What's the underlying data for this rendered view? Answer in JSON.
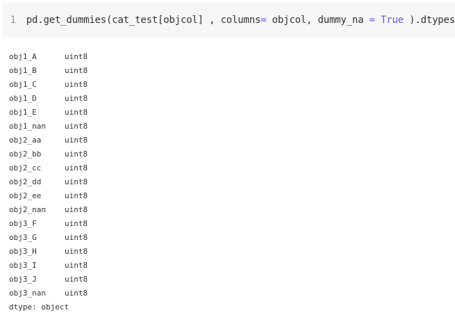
{
  "code_cell": {
    "line_number": "1",
    "code_parts": [
      {
        "text": "pd.get_dummies(cat_test[objcol] , columns",
        "cls": ""
      },
      {
        "text": "=",
        "cls": "op"
      },
      {
        "text": " objcol, dummy_na ",
        "cls": ""
      },
      {
        "text": "=",
        "cls": "op"
      },
      {
        "text": " ",
        "cls": ""
      },
      {
        "text": "True",
        "cls": "kw"
      },
      {
        "text": " ).dtypes",
        "cls": ""
      }
    ]
  },
  "output": {
    "rows": [
      {
        "name": "obj1_A",
        "dtype": "uint8"
      },
      {
        "name": "obj1_B",
        "dtype": "uint8"
      },
      {
        "name": "obj1_C",
        "dtype": "uint8"
      },
      {
        "name": "obj1_D",
        "dtype": "uint8"
      },
      {
        "name": "obj1_E",
        "dtype": "uint8"
      },
      {
        "name": "obj1_nan",
        "dtype": "uint8"
      },
      {
        "name": "obj2_aa",
        "dtype": "uint8"
      },
      {
        "name": "obj2_bb",
        "dtype": "uint8"
      },
      {
        "name": "obj2_cc",
        "dtype": "uint8"
      },
      {
        "name": "obj2_dd",
        "dtype": "uint8"
      },
      {
        "name": "obj2_ee",
        "dtype": "uint8"
      },
      {
        "name": "obj2_nan",
        "dtype": "uint8"
      },
      {
        "name": "obj3_F",
        "dtype": "uint8"
      },
      {
        "name": "obj3_G",
        "dtype": "uint8"
      },
      {
        "name": "obj3_H",
        "dtype": "uint8"
      },
      {
        "name": "obj3_I",
        "dtype": "uint8"
      },
      {
        "name": "obj3_J",
        "dtype": "uint8"
      },
      {
        "name": "obj3_nan",
        "dtype": "uint8"
      }
    ],
    "footer": "dtype: object"
  },
  "colors": {
    "code_background": "#f6f6f6",
    "line_number": "#9a9a9a",
    "text": "#333333",
    "operator_keyword": "#6a5acd"
  }
}
